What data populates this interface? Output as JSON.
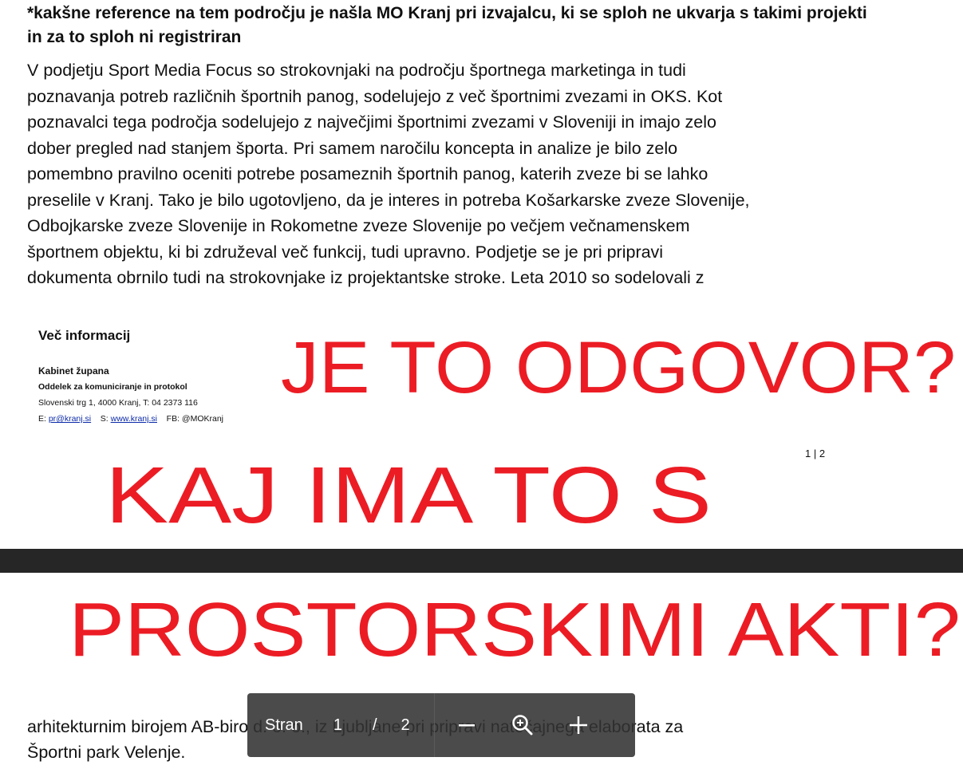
{
  "page1": {
    "heading": "*kakšne reference na tem področju je našla MO Kranj pri izvajalcu, ki se sploh ne ukvarja s takimi projekti in za to sploh ni registriran",
    "paragraph_lines": [
      "V podjetju Sport Media Focus so strokovnjaki na področju športnega marketinga in tudi",
      "poznavanja potreb različnih športnih panog, sodelujejo z več športnimi zvezami in OKS. Kot",
      "poznavalci tega področja sodelujejo z največjimi športnimi zvezami v Sloveniji in imajo zelo",
      "dober pregled nad stanjem športa. Pri samem naročilu koncepta in analize je bilo zelo",
      "pomembno pravilno oceniti potrebe posameznih športnih panog, katerih zveze bi se lahko",
      "preselile v Kranj. Tako je bilo ugotovljeno, da je interes in potreba Košarkarske zveze Slovenije,",
      "Odbojkarske zveze Slovenije in Rokometne zveze Slovenije po večjem večnamenskem",
      "športnem objektu, ki bi združeval več funkcij, tudi upravno. Podjetje se je pri pripravi",
      "dokumenta obrnilo tudi na strokovnjake iz projektantske stroke. Leta 2010 so sodelovali z"
    ],
    "footer": {
      "more_info": "Več informacij",
      "cabinet": "Kabinet župana",
      "department": "Oddelek za komuniciranje in protokol",
      "address": "Slovenski trg 1,  4000 Kranj,  T: 04 2373 116",
      "email_prefix": "E: ",
      "email": "pr@kranj.si",
      "web_prefix": "S: ",
      "web": "www.kranj.si",
      "fb": "FB: @MOKranj"
    },
    "page_number": "1 | 2"
  },
  "annotations": {
    "line1": "JE TO ODGOVOR?",
    "line2": "KAJ IMA TO S",
    "line3": "PROSTORSKIMI AKTI?",
    "color": "#ec1c24"
  },
  "page2": {
    "paragraph_lines": [
      "arhitekturnim birojem AB-biro d. o. o., iz Ljubljane pri pripravi natečajnega elaborata za",
      "Športni park Velenje."
    ]
  },
  "toolbar": {
    "page_label": "Stran",
    "current_page": "1",
    "separator": "/",
    "total_pages": "2",
    "zoom_icon": "zoom-in-icon",
    "minus_icon": "minus-icon",
    "plus_icon": "plus-icon"
  }
}
